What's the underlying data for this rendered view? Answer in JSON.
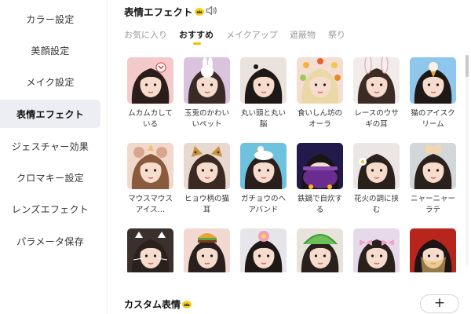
{
  "sidebar": {
    "items": [
      {
        "label": "カラー設定",
        "active": false
      },
      {
        "label": "美顔設定",
        "active": false
      },
      {
        "label": "メイク設定",
        "active": false
      },
      {
        "label": "表情エフェクト",
        "active": true
      },
      {
        "label": "ジェスチャー効果",
        "active": false
      },
      {
        "label": "クロマキー設定",
        "active": false
      },
      {
        "label": "レンズエフェクト",
        "active": false
      },
      {
        "label": "パラメータ保存",
        "active": false
      }
    ]
  },
  "section": {
    "title": "表情エフェクト",
    "premium_icon": "crown-icon",
    "sound_icon": "speaker-icon"
  },
  "tabs": [
    {
      "label": "お気に入り",
      "active": false
    },
    {
      "label": "おすすめ",
      "active": true
    },
    {
      "label": "メイクアップ",
      "active": false
    },
    {
      "label": "遮蔽物",
      "active": false
    },
    {
      "label": "祭り",
      "active": false
    }
  ],
  "effects": [
    {
      "label": "ムカムカしている",
      "prop": "angry-sticker",
      "bg": "#f3c9c9",
      "hair": "#2a1d1a"
    },
    {
      "label": "玉兎のかわいいペット",
      "prop": "bunny-toy",
      "bg": "#d9c3dd",
      "hair": "#3a2a26"
    },
    {
      "label": "丸い頭と丸い脳",
      "prop": "round-head",
      "bg": "#e9e2dd",
      "hair": "#1e1816"
    },
    {
      "label": "食いしん坊のオーラ",
      "prop": "food-halo",
      "bg": "#f4ddd2",
      "hair": "#ead8a6"
    },
    {
      "label": "レースのウサギの耳",
      "prop": "bunny-ears",
      "bg": "#f1ece9",
      "hair": "#3b2b24"
    },
    {
      "label": "猫のアイスクリーム",
      "prop": "ice-cream",
      "bg": "#8fc6ec",
      "hair": "#1e1816"
    },
    {
      "label": "マウスマウスアイス…",
      "prop": "mouse-ears",
      "bg": "#f1d8cc",
      "hair": "#8a5a3e"
    },
    {
      "label": "ヒョウ柄の猫耳",
      "prop": "leopard-ears",
      "bg": "#e7d9cf",
      "hair": "#3a2a22"
    },
    {
      "label": "ガチョウのヘアバンド",
      "prop": "goose",
      "bg": "#6fc2de",
      "hair": "#2a1f1c"
    },
    {
      "label": "鉄鍋で自炊する",
      "prop": "iron-pot",
      "bg": "#221a4a",
      "hair": "#1a1414"
    },
    {
      "label": "花火の調に挟む",
      "prop": "hair-flower",
      "bg": "#ebe6e3",
      "hair": "#2a201c"
    },
    {
      "label": "ニャーニャーラテ",
      "prop": "cat-hat",
      "bg": "#d3d7da",
      "hair": "#2a201c"
    },
    {
      "label": "",
      "prop": "cat-whiskers",
      "bg": "#3a302e",
      "hair": "#2a201c"
    },
    {
      "label": "",
      "prop": "burger-hat",
      "bg": "#f1d9d2",
      "hair": "#2a1f1c"
    },
    {
      "label": "",
      "prop": "pink-flower",
      "bg": "#e6e6ea",
      "hair": "#1e1816"
    },
    {
      "label": "",
      "prop": "watermelon",
      "bg": "#e8e3da",
      "hair": "#2a201c"
    },
    {
      "label": "",
      "prop": "pink-bows",
      "bg": "#e6d9ea",
      "hair": "#2a201c"
    },
    {
      "label": "",
      "prop": "red-veil",
      "bg": "#b8251d",
      "hair": "#1e1414"
    }
  ],
  "custom": {
    "title": "カスタム表情",
    "add_label": "+"
  }
}
